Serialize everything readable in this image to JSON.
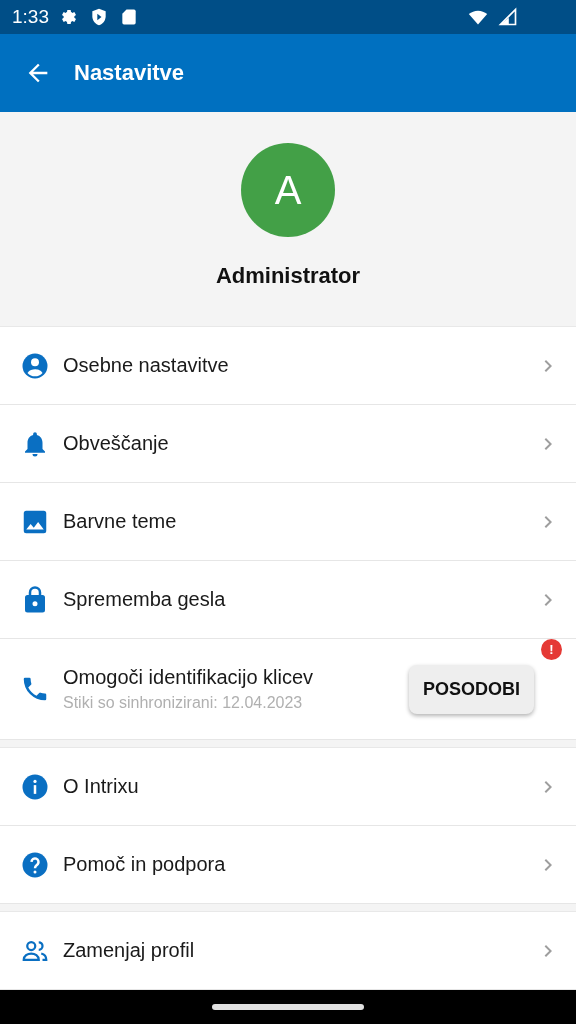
{
  "status_bar": {
    "time": "1:33"
  },
  "app_bar": {
    "title": "Nastavitve"
  },
  "profile": {
    "initial": "A",
    "name": "Administrator"
  },
  "sections": [
    {
      "items": [
        {
          "kind": "link",
          "label": "Osebne nastavitve"
        },
        {
          "kind": "link",
          "label": "Obveščanje"
        },
        {
          "kind": "link",
          "label": "Barvne teme"
        },
        {
          "kind": "link",
          "label": "Sprememba gesla"
        },
        {
          "kind": "action",
          "label": "Omogoči identifikacijo klicev",
          "subtitle": "Stiki so sinhronizirani: 12.04.2023",
          "button": "POSODOBI",
          "badge": "!"
        }
      ]
    },
    {
      "items": [
        {
          "kind": "link",
          "label": "O Intrixu"
        },
        {
          "kind": "link",
          "label": "Pomoč in podpora"
        }
      ]
    },
    {
      "items": [
        {
          "kind": "link",
          "label": "Zamenjaj profil"
        }
      ]
    }
  ]
}
